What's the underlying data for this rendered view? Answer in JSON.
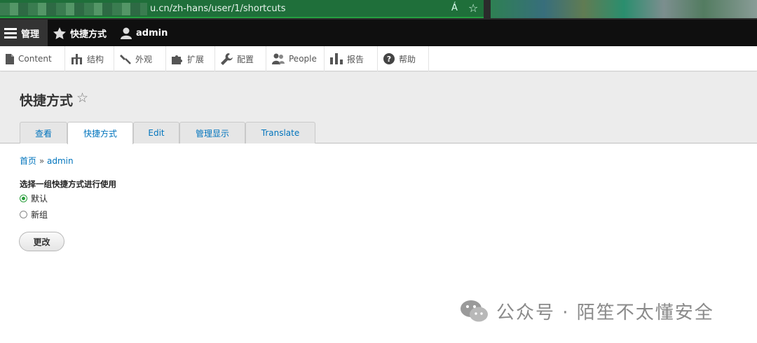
{
  "browser": {
    "url": "u.cn/zh-hans/user/1/shortcuts",
    "read_aloud": "Á",
    "favorite_icon": "star-outline-icon"
  },
  "toolbar": {
    "manage": "管理",
    "shortcuts": "快捷方式",
    "user": "admin"
  },
  "tray": [
    {
      "label": "Content",
      "icon": "page-icon"
    },
    {
      "label": "结构",
      "icon": "sitemap-icon"
    },
    {
      "label": "外观",
      "icon": "brush-icon"
    },
    {
      "label": "扩展",
      "icon": "puzzle-icon"
    },
    {
      "label": "配置",
      "icon": "wrench-icon"
    },
    {
      "label": "People",
      "icon": "people-icon"
    },
    {
      "label": "报告",
      "icon": "bar-chart-icon"
    },
    {
      "label": "帮助",
      "icon": "help-icon"
    }
  ],
  "page": {
    "title": "快捷方式",
    "tabs": [
      "查看",
      "快捷方式",
      "Edit",
      "管理显示",
      "Translate"
    ],
    "active_tab": "快捷方式"
  },
  "breadcrumb": {
    "home": "首页",
    "sep": "»",
    "current": "admin"
  },
  "form": {
    "label": "选择一组快捷方式进行使用",
    "options": [
      {
        "label": "默认",
        "checked": true
      },
      {
        "label": "新组",
        "checked": false
      }
    ],
    "submit": "更改"
  },
  "watermark": "公众号 · 陌笙不太懂安全",
  "colors": {
    "link": "#0074bd",
    "accent": "#2a9d3c",
    "toolbar": "#0f0f0f"
  }
}
